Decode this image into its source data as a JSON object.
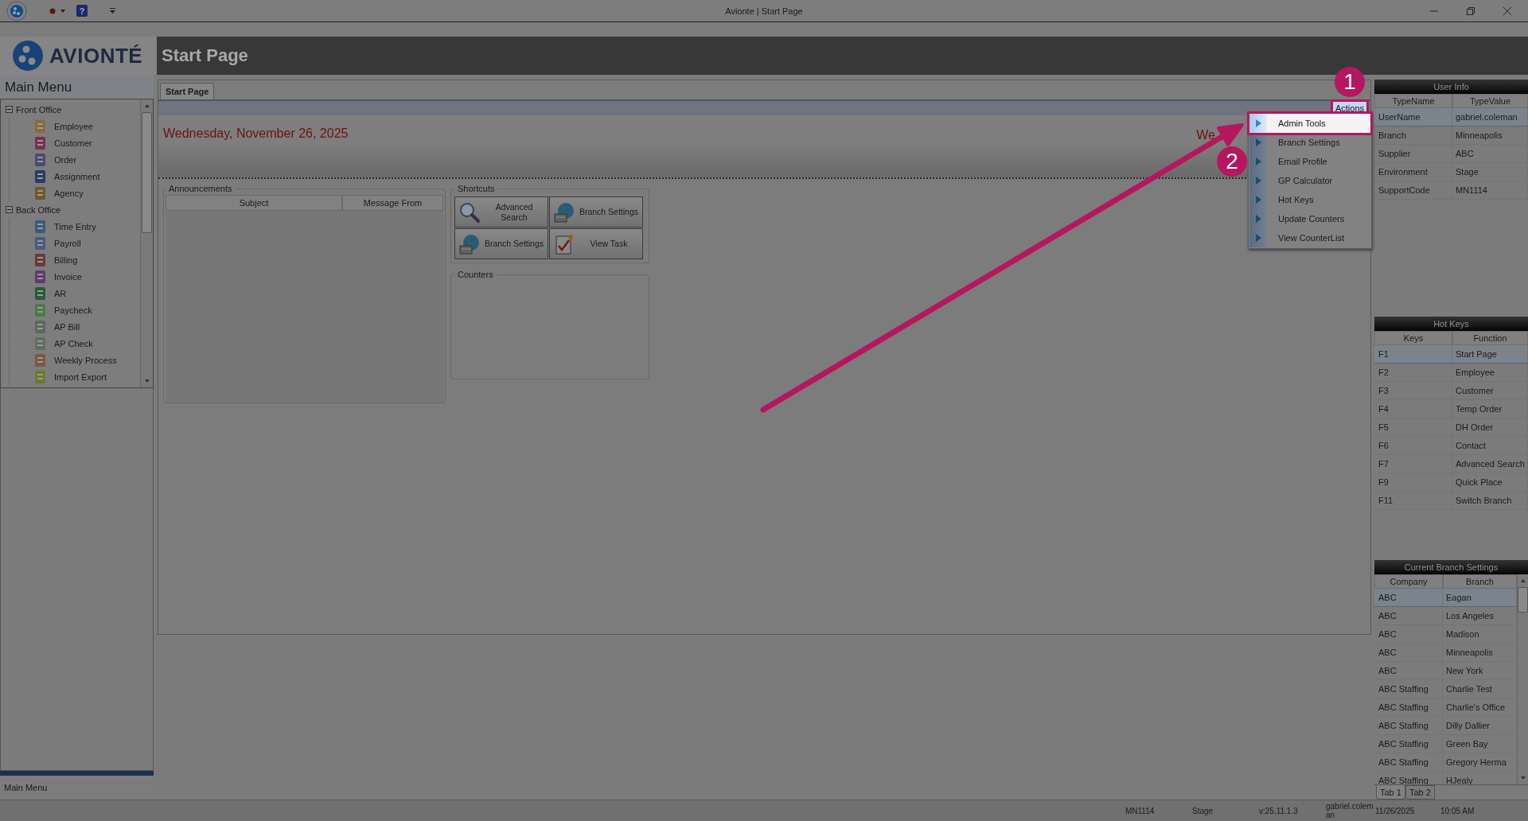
{
  "window": {
    "title": "Avionte | Start Page",
    "help_glyph": "?"
  },
  "app": {
    "logo_text": "AVIONTÉ",
    "page_title": "Start Page"
  },
  "sidebar": {
    "title": "Main Menu",
    "footer": "Main Menu",
    "groups": [
      {
        "label": "Front Office",
        "expanded": true,
        "children": [
          {
            "label": "Employee"
          },
          {
            "label": "Customer"
          },
          {
            "label": "Order"
          },
          {
            "label": "Assignment"
          },
          {
            "label": "Agency"
          }
        ]
      },
      {
        "label": "Back Office",
        "expanded": true,
        "children": [
          {
            "label": "Time Entry"
          },
          {
            "label": "Payroll"
          },
          {
            "label": "Billing"
          },
          {
            "label": "Invoice"
          },
          {
            "label": "AR"
          },
          {
            "label": "Paycheck"
          },
          {
            "label": "AP Bill"
          },
          {
            "label": "AP Check"
          },
          {
            "label": "Weekly Process"
          },
          {
            "label": "Import Export"
          }
        ]
      }
    ]
  },
  "tabs": [
    {
      "label": "Start Page",
      "selected": true
    }
  ],
  "actions": {
    "label": "Actions",
    "highlighted": true,
    "menu": [
      {
        "label": "Admin Tools",
        "highlighted": true
      },
      {
        "label": "Branch Settings",
        "highlighted": false
      },
      {
        "label": "Email Profile",
        "highlighted": false
      },
      {
        "label": "GP Calculator",
        "highlighted": false
      },
      {
        "label": "Hot Keys",
        "highlighted": false
      },
      {
        "label": "Update Counters",
        "highlighted": false
      },
      {
        "label": "View CounterList",
        "highlighted": false
      }
    ]
  },
  "date": "Wednesday, November 26, 2025",
  "welcome": "We",
  "announcements": {
    "title": "Announcements",
    "columns": [
      "Subject",
      "Message From"
    ]
  },
  "shortcuts": {
    "title": "Shortcuts",
    "buttons": [
      {
        "label": "Advanced Search",
        "kind": "search"
      },
      {
        "label": "Branch Settings",
        "kind": "globe"
      },
      {
        "label": "Branch Settings",
        "kind": "globe"
      },
      {
        "label": "View Task",
        "kind": "task"
      }
    ]
  },
  "counters": {
    "title": "Counters"
  },
  "user_info": {
    "title": "User Info",
    "columns": [
      "TypeName",
      "TypeValue"
    ],
    "rows": [
      {
        "cells": [
          "UserName",
          "gabriel.coleman"
        ],
        "selected": true
      },
      {
        "cells": [
          "Branch",
          "Minneapolis"
        ],
        "selected": false
      },
      {
        "cells": [
          "Supplier",
          "ABC"
        ],
        "selected": false
      },
      {
        "cells": [
          "Environment",
          "Stage"
        ],
        "selected": false
      },
      {
        "cells": [
          "SupportCode",
          "MN1114"
        ],
        "selected": false
      }
    ]
  },
  "hot_keys": {
    "title": "Hot Keys",
    "columns": [
      "Keys",
      "Function"
    ],
    "rows": [
      {
        "cells": [
          "F1",
          "Start Page"
        ],
        "selected": true
      },
      {
        "cells": [
          "F2",
          "Employee"
        ],
        "selected": false
      },
      {
        "cells": [
          "F3",
          "Customer"
        ],
        "selected": false
      },
      {
        "cells": [
          "F4",
          "Temp Order"
        ],
        "selected": false
      },
      {
        "cells": [
          "F5",
          "DH Order"
        ],
        "selected": false
      },
      {
        "cells": [
          "F6",
          "Contact"
        ],
        "selected": false
      },
      {
        "cells": [
          "F7",
          "Advanced Search"
        ],
        "selected": false
      },
      {
        "cells": [
          "F9",
          "Quick Place"
        ],
        "selected": false
      },
      {
        "cells": [
          "F11",
          "Switch Branch"
        ],
        "selected": false
      }
    ]
  },
  "branch_settings": {
    "title": "Current Branch Settings",
    "columns": [
      "Company",
      "Branch"
    ],
    "rows": [
      {
        "cells": [
          "ABC",
          "Eagan"
        ],
        "selected": true
      },
      {
        "cells": [
          "ABC",
          "Los Angeles"
        ],
        "selected": false
      },
      {
        "cells": [
          "ABC",
          "Madison"
        ],
        "selected": false
      },
      {
        "cells": [
          "ABC",
          "Minneapolis"
        ],
        "selected": false
      },
      {
        "cells": [
          "ABC",
          "New York"
        ],
        "selected": false
      },
      {
        "cells": [
          "ABC Staffing",
          "Charlie Test"
        ],
        "selected": false
      },
      {
        "cells": [
          "ABC Staffing",
          "Charlie's Office"
        ],
        "selected": false
      },
      {
        "cells": [
          "ABC Staffing",
          "Dilly Dallier"
        ],
        "selected": false
      },
      {
        "cells": [
          "ABC Staffing",
          "Green Bay"
        ],
        "selected": false
      },
      {
        "cells": [
          "ABC Staffing",
          "Gregory Herma"
        ],
        "selected": false
      },
      {
        "cells": [
          "ABC Staffing",
          "HJealy"
        ],
        "selected": false
      }
    ],
    "tabs": [
      {
        "label": "Tab 1",
        "selected": true
      },
      {
        "label": "Tab 2",
        "selected": false
      }
    ]
  },
  "status_bar": [
    "MN1114",
    "Stage",
    "v:25.11.1.3",
    "gabriel.coleman",
    "11/26/2025",
    "10:05 AM"
  ],
  "annotations": [
    {
      "label": "1"
    },
    {
      "label": "2"
    }
  ]
}
